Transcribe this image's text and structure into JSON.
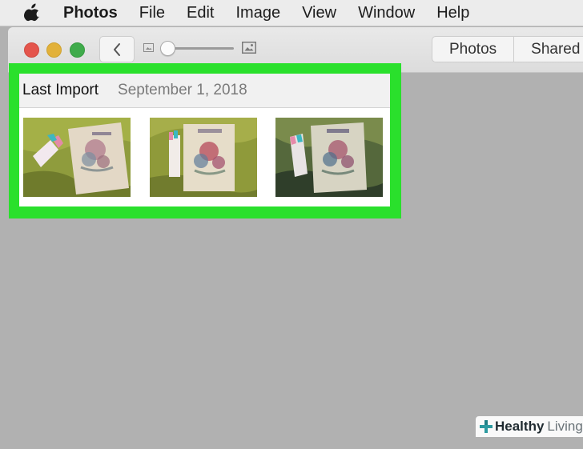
{
  "menubar": {
    "app_name": "Photos",
    "items": [
      "File",
      "Edit",
      "Image",
      "View",
      "Window",
      "Help"
    ]
  },
  "toolbar": {
    "zoom_level": 0.0,
    "segments": [
      "Photos",
      "Shared"
    ]
  },
  "import_section": {
    "title": "Last Import",
    "date": "September 1, 2018",
    "highlight_color": "#2ae02c"
  },
  "watermark": {
    "brand_primary": "Healthy",
    "brand_secondary": "Living"
  }
}
